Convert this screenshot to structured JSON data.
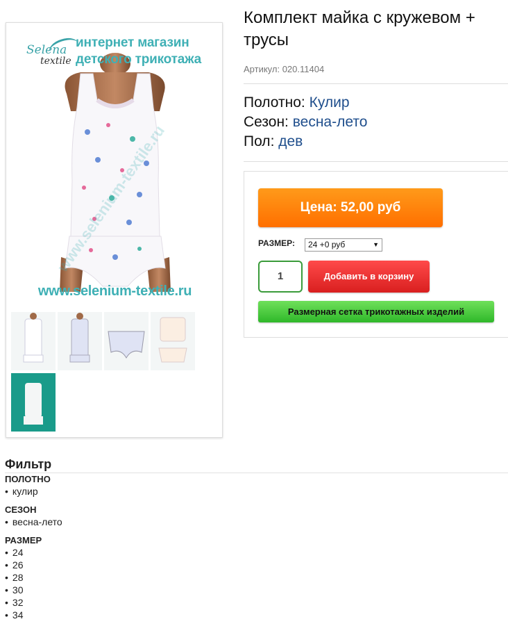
{
  "gallery": {
    "logo_text_1": "Selena",
    "logo_text_2": "textile",
    "tagline": "интернет магазин детского трикотажа",
    "watermark_url": "www.selenium-textile.ru",
    "thumbnail_count": 5
  },
  "product": {
    "title": "Комплект майка с кружевом + трусы",
    "sku": "Артикул: 020.11404",
    "attributes": [
      {
        "label": "Полотно: ",
        "value": "Кулир"
      },
      {
        "label": "Сезон: ",
        "value": "весна-лето"
      },
      {
        "label": "Пол: ",
        "value": "дев"
      }
    ]
  },
  "buy": {
    "price_label": "Цена: 52,00 руб",
    "size_label": "РАЗМЕР:",
    "size_selected": "24 +0 руб",
    "quantity": "1",
    "add_to_cart": "Добавить в корзину",
    "size_chart": "Размерная сетка трикотажных изделий"
  },
  "filter": {
    "title": "Фильтр",
    "groups": [
      {
        "title": "ПОЛОТНО",
        "items": [
          "кулир"
        ]
      },
      {
        "title": "СЕЗОН",
        "items": [
          "весна-лето"
        ]
      },
      {
        "title": "РАЗМЕР",
        "items": [
          "24",
          "26",
          "28",
          "30",
          "32",
          "34"
        ]
      }
    ]
  },
  "colors": {
    "price": "#ff7f00",
    "cart": "#e52b2b",
    "chart": "#3fc53a",
    "brand_teal": "#3fb0b5",
    "link": "#1f4e8c"
  }
}
